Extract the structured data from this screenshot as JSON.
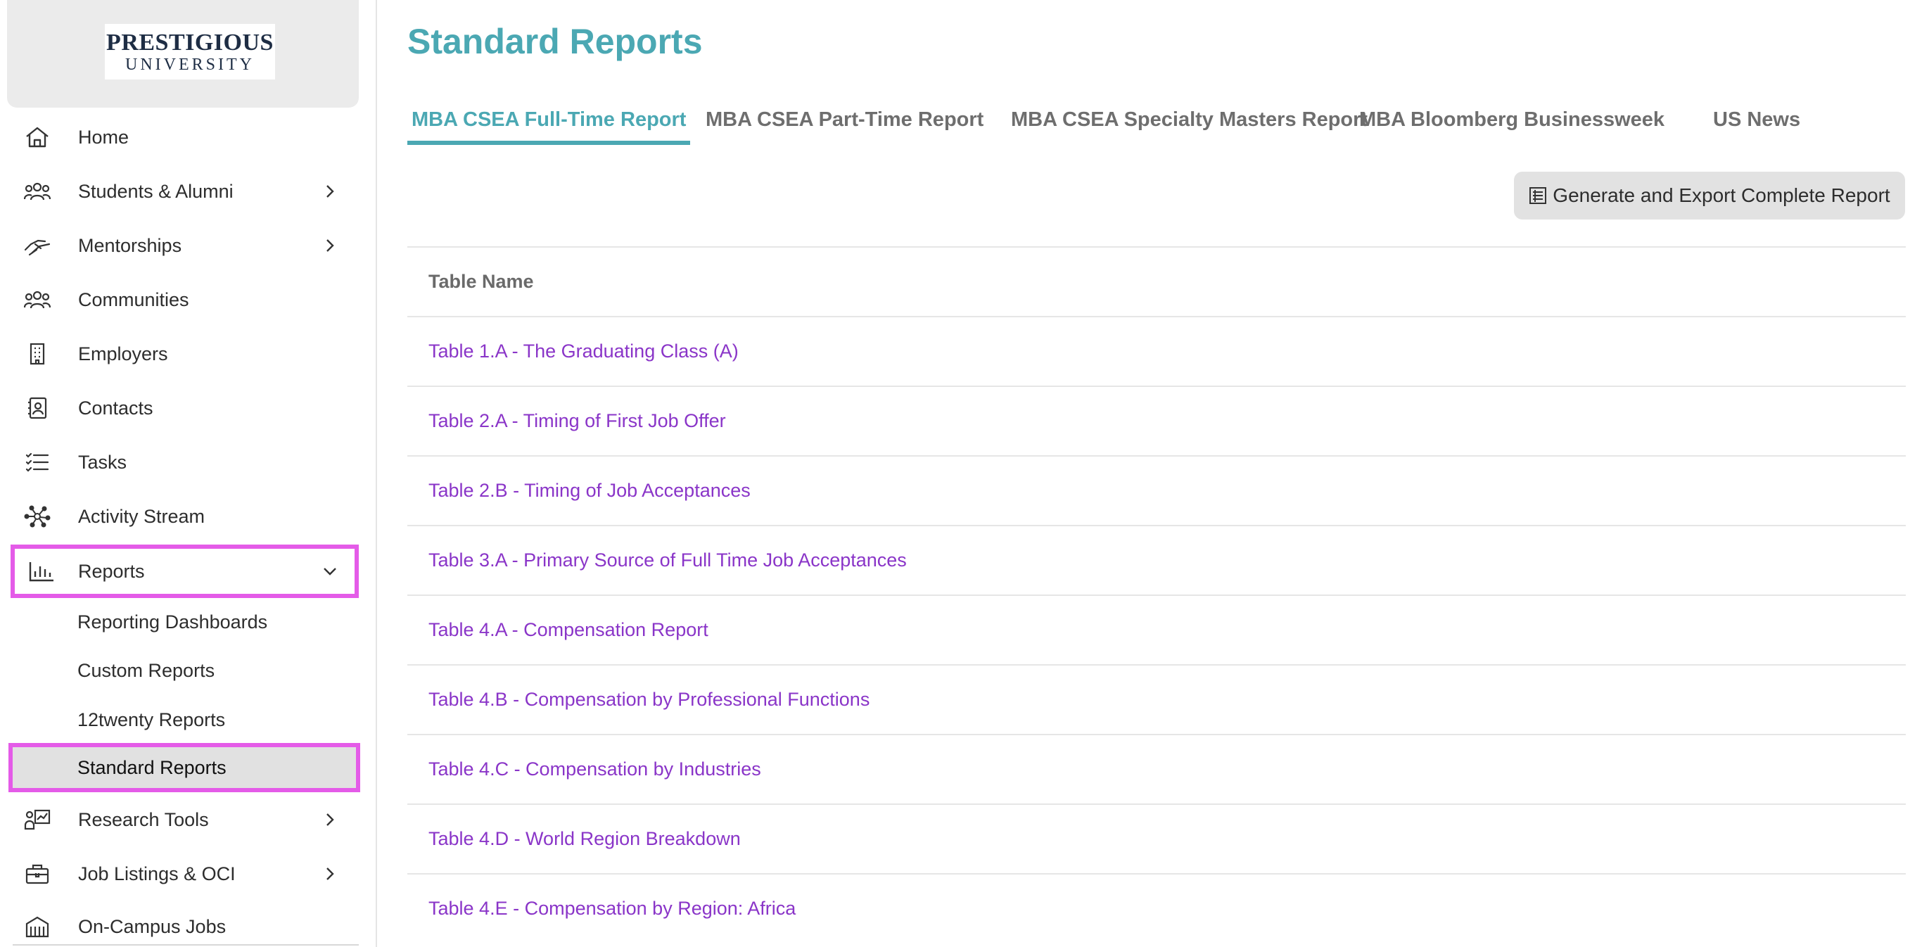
{
  "logo": {
    "line1": "PRESTIGIOUS",
    "line2": "UNIVERSITY"
  },
  "sidebar": {
    "items": [
      {
        "label": "Home",
        "icon": "home-icon",
        "chevron": false
      },
      {
        "label": "Students & Alumni",
        "icon": "people-icon",
        "chevron": true
      },
      {
        "label": "Mentorships",
        "icon": "handshake-icon",
        "chevron": true
      },
      {
        "label": "Communities",
        "icon": "community-icon",
        "chevron": false
      },
      {
        "label": "Employers",
        "icon": "building-icon",
        "chevron": false
      },
      {
        "label": "Contacts",
        "icon": "contact-card-icon",
        "chevron": false
      },
      {
        "label": "Tasks",
        "icon": "checklist-icon",
        "chevron": false
      },
      {
        "label": "Activity Stream",
        "icon": "network-icon",
        "chevron": false
      },
      {
        "label": "Reports",
        "icon": "bar-chart-icon",
        "chevron": "down"
      },
      {
        "label": "Research Tools",
        "icon": "research-icon",
        "chevron": true
      },
      {
        "label": "Job Listings & OCI",
        "icon": "briefcase-icon",
        "chevron": true
      },
      {
        "label": "On-Campus Jobs",
        "icon": "campus-icon",
        "chevron": false
      }
    ],
    "reports_sub": [
      {
        "label": "Reporting Dashboards"
      },
      {
        "label": "Custom Reports"
      },
      {
        "label": "12twenty Reports"
      },
      {
        "label": "Standard Reports"
      }
    ]
  },
  "main": {
    "title": "Standard Reports",
    "tabs": [
      {
        "label": "MBA CSEA Full-Time Report"
      },
      {
        "label": "MBA CSEA Part-Time Report"
      },
      {
        "label": "MBA CSEA Specialty Masters Report"
      },
      {
        "label": "MBA Bloomberg Businessweek"
      },
      {
        "label": "US News"
      }
    ],
    "export_button": "Generate and Export Complete Report",
    "table_header": "Table Name",
    "rows": [
      "Table 1.A - The Graduating Class (A)",
      "Table 2.A - Timing of First Job Offer",
      "Table 2.B - Timing of Job Acceptances",
      "Table 3.A - Primary Source of Full Time Job Acceptances",
      "Table 4.A - Compensation Report",
      "Table 4.B - Compensation by Professional Functions",
      "Table 4.C - Compensation by Industries",
      "Table 4.D - World Region Breakdown",
      "Table 4.E - Compensation by Region: Africa"
    ]
  },
  "colors": {
    "accent": "#4ba8b3",
    "link": "#8a35c8",
    "highlight_outline": "#e45be8"
  }
}
